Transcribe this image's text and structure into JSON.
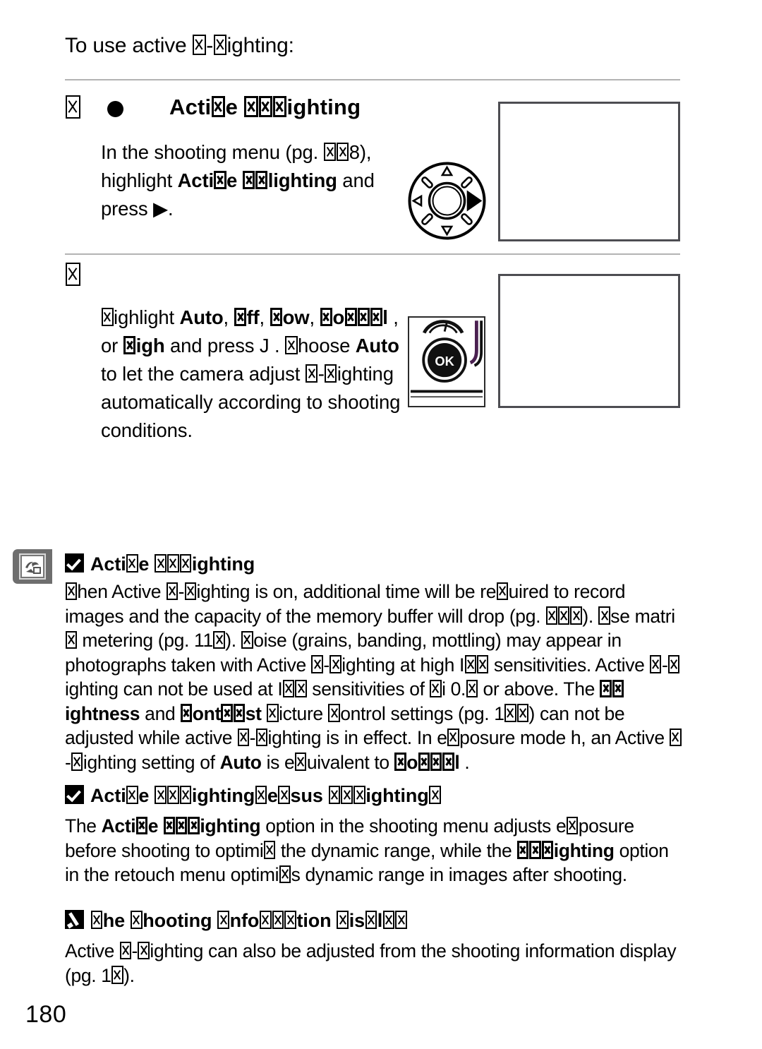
{
  "document": {
    "page_number": "180",
    "intro_line": "To use active ▨-▨ighting:"
  },
  "colors": {
    "text": "#000000",
    "rule": "#b3b3b3",
    "screen_border": "#4d4d52",
    "tab_gray": "#6e6e6e"
  },
  "steps": [
    {
      "number": "▨",
      "bullet": "filled-circle",
      "heading": "Acti▨e ▨▨▨ighting",
      "body_runs": [
        {
          "text": "In the shooting menu (pg. ",
          "bold": false
        },
        {
          "text": "▨▨8)",
          "bold": false
        },
        {
          "text": ", highlight ",
          "bold": false
        },
        {
          "text": "Acti▨e ▨▨lighting",
          "bold": true
        },
        {
          "text": " and press ▶.",
          "bold": false
        }
      ],
      "illustration": "multi-selector",
      "screen": "empty-menu-screen"
    },
    {
      "number": "▨",
      "bullet": null,
      "heading": "",
      "body_runs": [
        {
          "text": "▨ighlight ",
          "bold": false
        },
        {
          "text": "Auto",
          "bold": true
        },
        {
          "text": ", ",
          "bold": false
        },
        {
          "text": "▨ff",
          "bold": true
        },
        {
          "text": ", ",
          "bold": false
        },
        {
          "text": "▨ow",
          "bold": true
        },
        {
          "text": ", ",
          "bold": false
        },
        {
          "text": "▨o▨▨▨l",
          "bold": true
        },
        {
          "text": " , or ",
          "bold": false
        },
        {
          "text": "▨igh",
          "bold": true
        },
        {
          "text": " and press J . ",
          "bold": false
        },
        {
          "text": "▨hoose ",
          "bold": false
        },
        {
          "text": "Auto",
          "bold": true
        },
        {
          "text": " to let the camera adjust ▨-▨ighting automatically according to shooting conditions.",
          "bold": false
        }
      ],
      "illustration": "ok-button",
      "screen": "empty-options-screen"
    }
  ],
  "notes": [
    {
      "icon": "check-square-icon",
      "heading": "Acti▨e ▨▨▨ighting",
      "paragraph_runs": [
        {
          "text": "▨hen Active ▨-▨ighting is on, additional time will be re▨uired to record images and the capacity of the memory buffer will drop (pg. ▨▨▨).  ▨se matri▨ metering (pg. 11▨). ▨oise (grains, banding, mottling) may appear in photographs taken with Active ▨-▨ighting at high I▨▨ sensitivities. Active ▨-▨ighting can not be used at I▨▨ sensitivities of ▨i 0.▨ or above. The ",
          "bold": false
        },
        {
          "text": "▨▨ightness",
          "bold": true
        },
        {
          "text": " and ",
          "bold": false
        },
        {
          "text": "▨ont▨▨st",
          "bold": true
        },
        {
          "text": " ▨icture ▨ontrol settings (pg. 1▨▨) can not be adjusted while active ▨-▨ighting is in effect.  In e▨posure mode h, an Active ▨-▨ighting setting of ",
          "bold": false
        },
        {
          "text": "Auto",
          "bold": true
        },
        {
          "text": " is e▨uivalent to ",
          "bold": false
        },
        {
          "text": "▨o▨▨▨l",
          "bold": true
        },
        {
          "text": " .",
          "bold": false
        }
      ]
    },
    {
      "icon": "check-square-icon",
      "heading": "Acti▨e ▨▨▨ighting▨e▨sus ▨▨▨ighting▨",
      "paragraph_runs": [
        {
          "text": "The ",
          "bold": false
        },
        {
          "text": "Acti▨e ▨▨▨ighting",
          "bold": true
        },
        {
          "text": " option in the shooting menu adjusts e▨posure before shooting to optimi▨ the dynamic range, while the  ",
          "bold": false
        },
        {
          "text": "▨▨▨ighting",
          "bold": true
        },
        {
          "text": " option in the retouch menu optimi▨s dynamic range in images after shooting.",
          "bold": false
        }
      ]
    },
    {
      "icon": "pencil-square-icon",
      "heading": "▨he ▨hooting ▨nfo▨▨▨tion ▨is▨l▨▨",
      "paragraph_runs": [
        {
          "text": "Active ▨-▨ighting can also be adjusted from the shooting information display (pg. 1▨).",
          "bold": false
        }
      ]
    }
  ]
}
